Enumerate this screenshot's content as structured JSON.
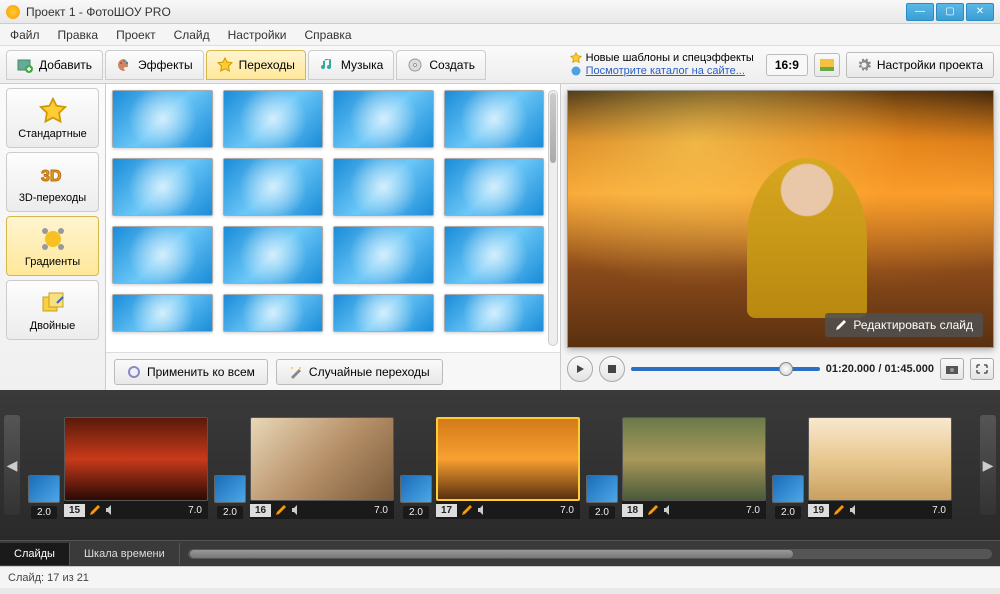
{
  "titlebar": {
    "title": "Проект 1 - ФотоШОУ PRO"
  },
  "menu": [
    "Файл",
    "Правка",
    "Проект",
    "Слайд",
    "Настройки",
    "Справка"
  ],
  "tabs": {
    "add": "Добавить",
    "effects": "Эффекты",
    "transitions": "Переходы",
    "music": "Музыка",
    "create": "Создать"
  },
  "notes": {
    "line1": "Новые шаблоны и спецэффекты",
    "line2": "Посмотрите каталог на сайте..."
  },
  "aspect": "16:9",
  "project_settings": "Настройки проекта",
  "sidebar": {
    "standard": "Стандартные",
    "three_d": "3D-переходы",
    "gradients": "Градиенты",
    "doubles": "Двойные"
  },
  "gallery_footer": {
    "apply_all": "Применить ко всем",
    "random": "Случайные переходы"
  },
  "preview": {
    "edit_slide": "Редактировать слайд",
    "time": "01:20.000 / 01:45.000"
  },
  "timeline": {
    "trans_dur": "2.0",
    "slides": [
      {
        "n": "15",
        "dur": "7.0"
      },
      {
        "n": "16",
        "dur": "7.0"
      },
      {
        "n": "17",
        "dur": "7.0"
      },
      {
        "n": "18",
        "dur": "7.0"
      },
      {
        "n": "19",
        "dur": "7.0"
      }
    ]
  },
  "bottom": {
    "slides": "Слайды",
    "timescale": "Шкала времени"
  },
  "status": "Слайд: 17 из 21"
}
